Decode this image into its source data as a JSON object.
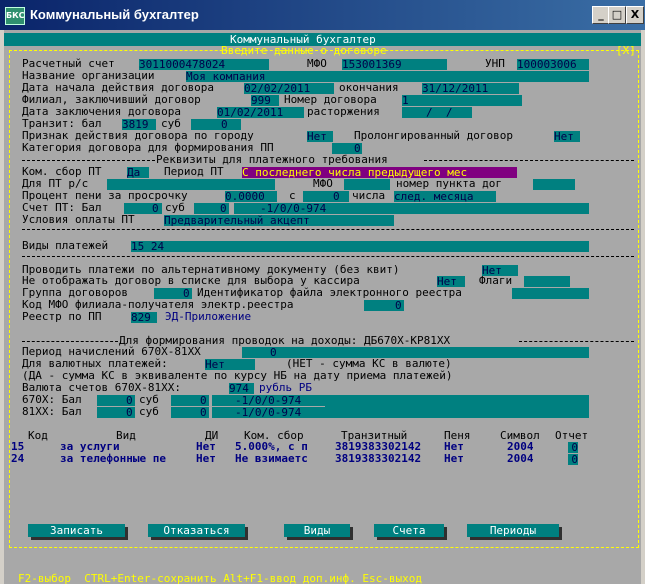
{
  "window": {
    "title": "Коммунальный бухгалтер",
    "icon_text": "БКС",
    "btn_min": "_",
    "btn_max": "□",
    "btn_close": "X"
  },
  "console": {
    "caption": "Коммунальный бухгалтер",
    "subtitle": "Введите данные о договоре",
    "close": "[X]"
  },
  "f": {
    "acct_label": "Расчетный счет",
    "acct": "3011000478024",
    "mfo_label": "МФО",
    "mfo": "153001369",
    "unp_label": "УНП",
    "unp": "100003006",
    "org_label": "Название организации",
    "org": "Моя компания",
    "start_label": "Дата начала действия договора",
    "start": "02/02/2011",
    "end_label": "окончания",
    "end": "31/12/2011",
    "branch_label": "Филиал, заключивший договор",
    "branch": "999",
    "num_label": "Номер договора",
    "num": "1",
    "sign_label": "Дата заключения договора",
    "sign": "01/02/2011",
    "term_label": "расторжения",
    "term": "/  /",
    "transit_label": "Транзит: бал",
    "transit_bal": "3819",
    "transit_sub_label": "суб",
    "transit_sub": "0",
    "city_label": "Признак действия договора по городу",
    "city": "Нет",
    "prolong_label": "Пролонгированный договор",
    "prolong": "Нет",
    "cat_label": "Категория договора для формирования ПП",
    "cat": "0",
    "pt_section": "Реквизиты для платежного требования",
    "fee_label": "Ком. сбор ПТ",
    "fee": "Да",
    "period_label": "Период ПТ",
    "period": "С последнего числа предыдущего мес",
    "pt_rs_label": "Для ПТ р/с",
    "pt_mfo_label": "МФО",
    "point_label": "номер пункта дог",
    "pen_label": "Процент пени за просрочку",
    "pen": "0.0000",
    "pen_c": "с",
    "pen_n": "0",
    "pen_days": "числа",
    "pen_month": "след. месяца",
    "pt_acct_label": "Счет ПТ: Бал",
    "pt_bal": "0",
    "pt_sub_label": "суб",
    "pt_sub": "0",
    "pt_code": "-1/0/0-974",
    "terms_label": "Условия оплаты ПТ",
    "terms": "Предварительный акцепт",
    "types_label": "Виды платежей",
    "types": "15 24",
    "alt_label": "Проводить платежи по альтернативному документу (без квит)",
    "alt": "Нет",
    "hide_label": "Не отображать договор в списке для выбора у кассира",
    "hide": "Нет",
    "flags_label": "Флаги",
    "group_label": "Группа договоров",
    "group": "0",
    "eid_label": "Идентификатор файла электронного реестра",
    "mfo_recv_label": "Код МФО филиала-получателя электр.реестра",
    "mfo_recv": "0",
    "reg_label": "Реестр по ПП",
    "reg_code": "829",
    "reg_name": "ЭД-Приложение",
    "income_section": "Для формирования проводок на доходы: ДБ670Х-КР81ХХ",
    "accr_label": "Период начислений 670Х-81ХХ",
    "accr": "0",
    "cur_label": "Для валютных платежей:",
    "cur": "Нет",
    "cur_note": "(НЕТ - сумма КС в валюте)",
    "cur_note2": "(ДА - сумма КС в эквиваленте по курсу НБ на дату приема платежей)",
    "valacc_label": "Валюта счетов 670Х-81ХХ:",
    "valacc_code": "974",
    "valacc_name": "рубль РБ",
    "a670_label": "670Х: Бал",
    "a670_bal": "0",
    "a670_sub_label": "суб",
    "a670_sub": "0",
    "a670_code": "-1/0/0-974",
    "a81_label": "81ХХ: Бал",
    "a81_bal": "0",
    "a81_sub_label": "суб",
    "a81_sub": "0",
    "a81_code": "-1/0/0-974"
  },
  "table": {
    "headers": {
      "code": "Код",
      "kind": "Вид",
      "di": "ДИ",
      "fee": "Ком. сбор",
      "transit": "Транзитный",
      "pen": "Пеня",
      "sym": "Символ",
      "rep": "Отчет"
    },
    "rows": [
      {
        "code": "15",
        "kind": "за услуги",
        "di": "Нет",
        "fee": "5.000%, с п",
        "transit": "3819383302142",
        "pen": "Нет",
        "sym": "2004",
        "rep": "0"
      },
      {
        "code": "24",
        "kind": "за телефонные пе",
        "di": "Нет",
        "fee": "Не взимаетс",
        "transit": "3819383302142",
        "pen": "Нет",
        "sym": "2004",
        "rep": "0"
      }
    ]
  },
  "buttons": {
    "save": "Записать",
    "cancel": "Отказаться",
    "types": "Виды",
    "accounts": "Счета",
    "periods": "Периоды"
  },
  "status": "F2-выбор  CTRL+Enter-сохранить Alt+F1-ввод доп.инф. Esc-выход"
}
